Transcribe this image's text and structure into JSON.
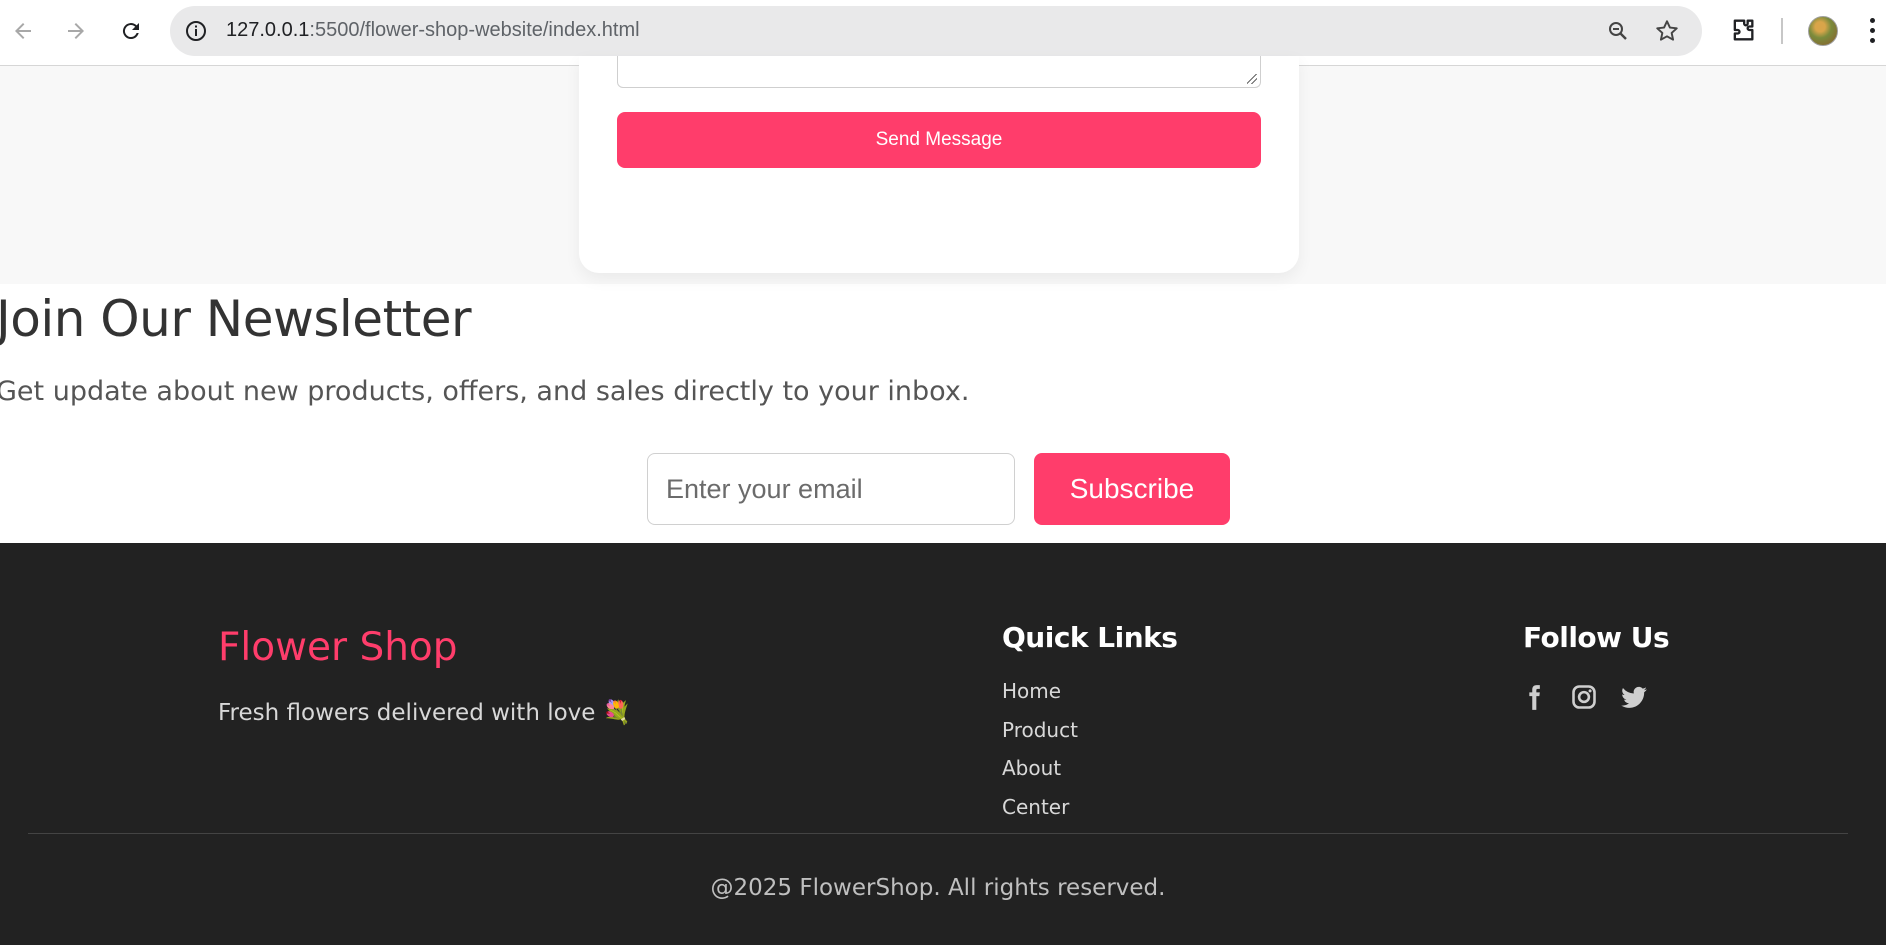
{
  "browser": {
    "url_host": "127.0.0.1",
    "url_rest": ":5500/flower-shop-website/index.html"
  },
  "contact": {
    "send_label": "Send Message"
  },
  "newsletter": {
    "title": "Join Our Newsletter",
    "text": "Get update about new products, offers, and sales directly to your inbox.",
    "email_placeholder": "Enter your email",
    "subscribe_label": "Subscribe"
  },
  "footer": {
    "brand": "Flower Shop",
    "tagline": "Fresh flowers delivered with love 💐",
    "quick_links_title": "Quick Links",
    "links": [
      "Home",
      "Product",
      "About",
      "Center"
    ],
    "follow_title": "Follow Us",
    "social_icons": [
      "facebook-icon",
      "instagram-icon",
      "twitter-icon"
    ],
    "copyright": "@2025 FlowerShop. All rights reserved."
  },
  "colors": {
    "accent": "#ff3d6b",
    "footer_bg": "#222222",
    "contact_bg": "#f8f8f8"
  }
}
